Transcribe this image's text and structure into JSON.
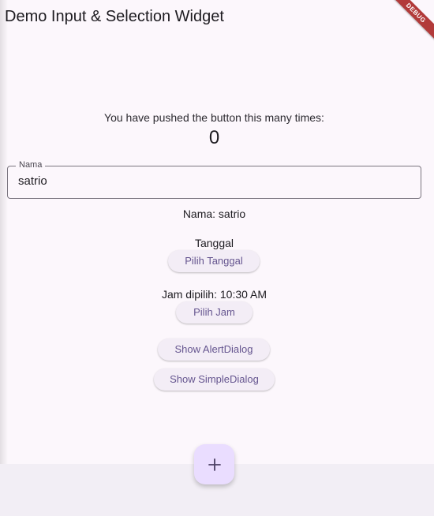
{
  "app": {
    "title": "Demo Input & Selection Widget",
    "debug_banner": "DEBUG"
  },
  "counter": {
    "label": "You have pushed the button this many times:",
    "value": "0"
  },
  "name_field": {
    "label": "Nama",
    "value": "satrio"
  },
  "name_display": "Nama: satrio",
  "date": {
    "label": "Tanggal",
    "button": "Pilih Tanggal"
  },
  "time": {
    "label": "Jam dipilih: 10:30 AM",
    "button": "Pilih Jam"
  },
  "dialogs": {
    "alert_button": "Show AlertDialog",
    "simple_button": "Show SimpleDialog"
  },
  "fab": {
    "icon": "plus-icon"
  },
  "colors": {
    "background": "#fcf7fc",
    "button_text": "#65558f",
    "fab_background": "#eaddff"
  }
}
